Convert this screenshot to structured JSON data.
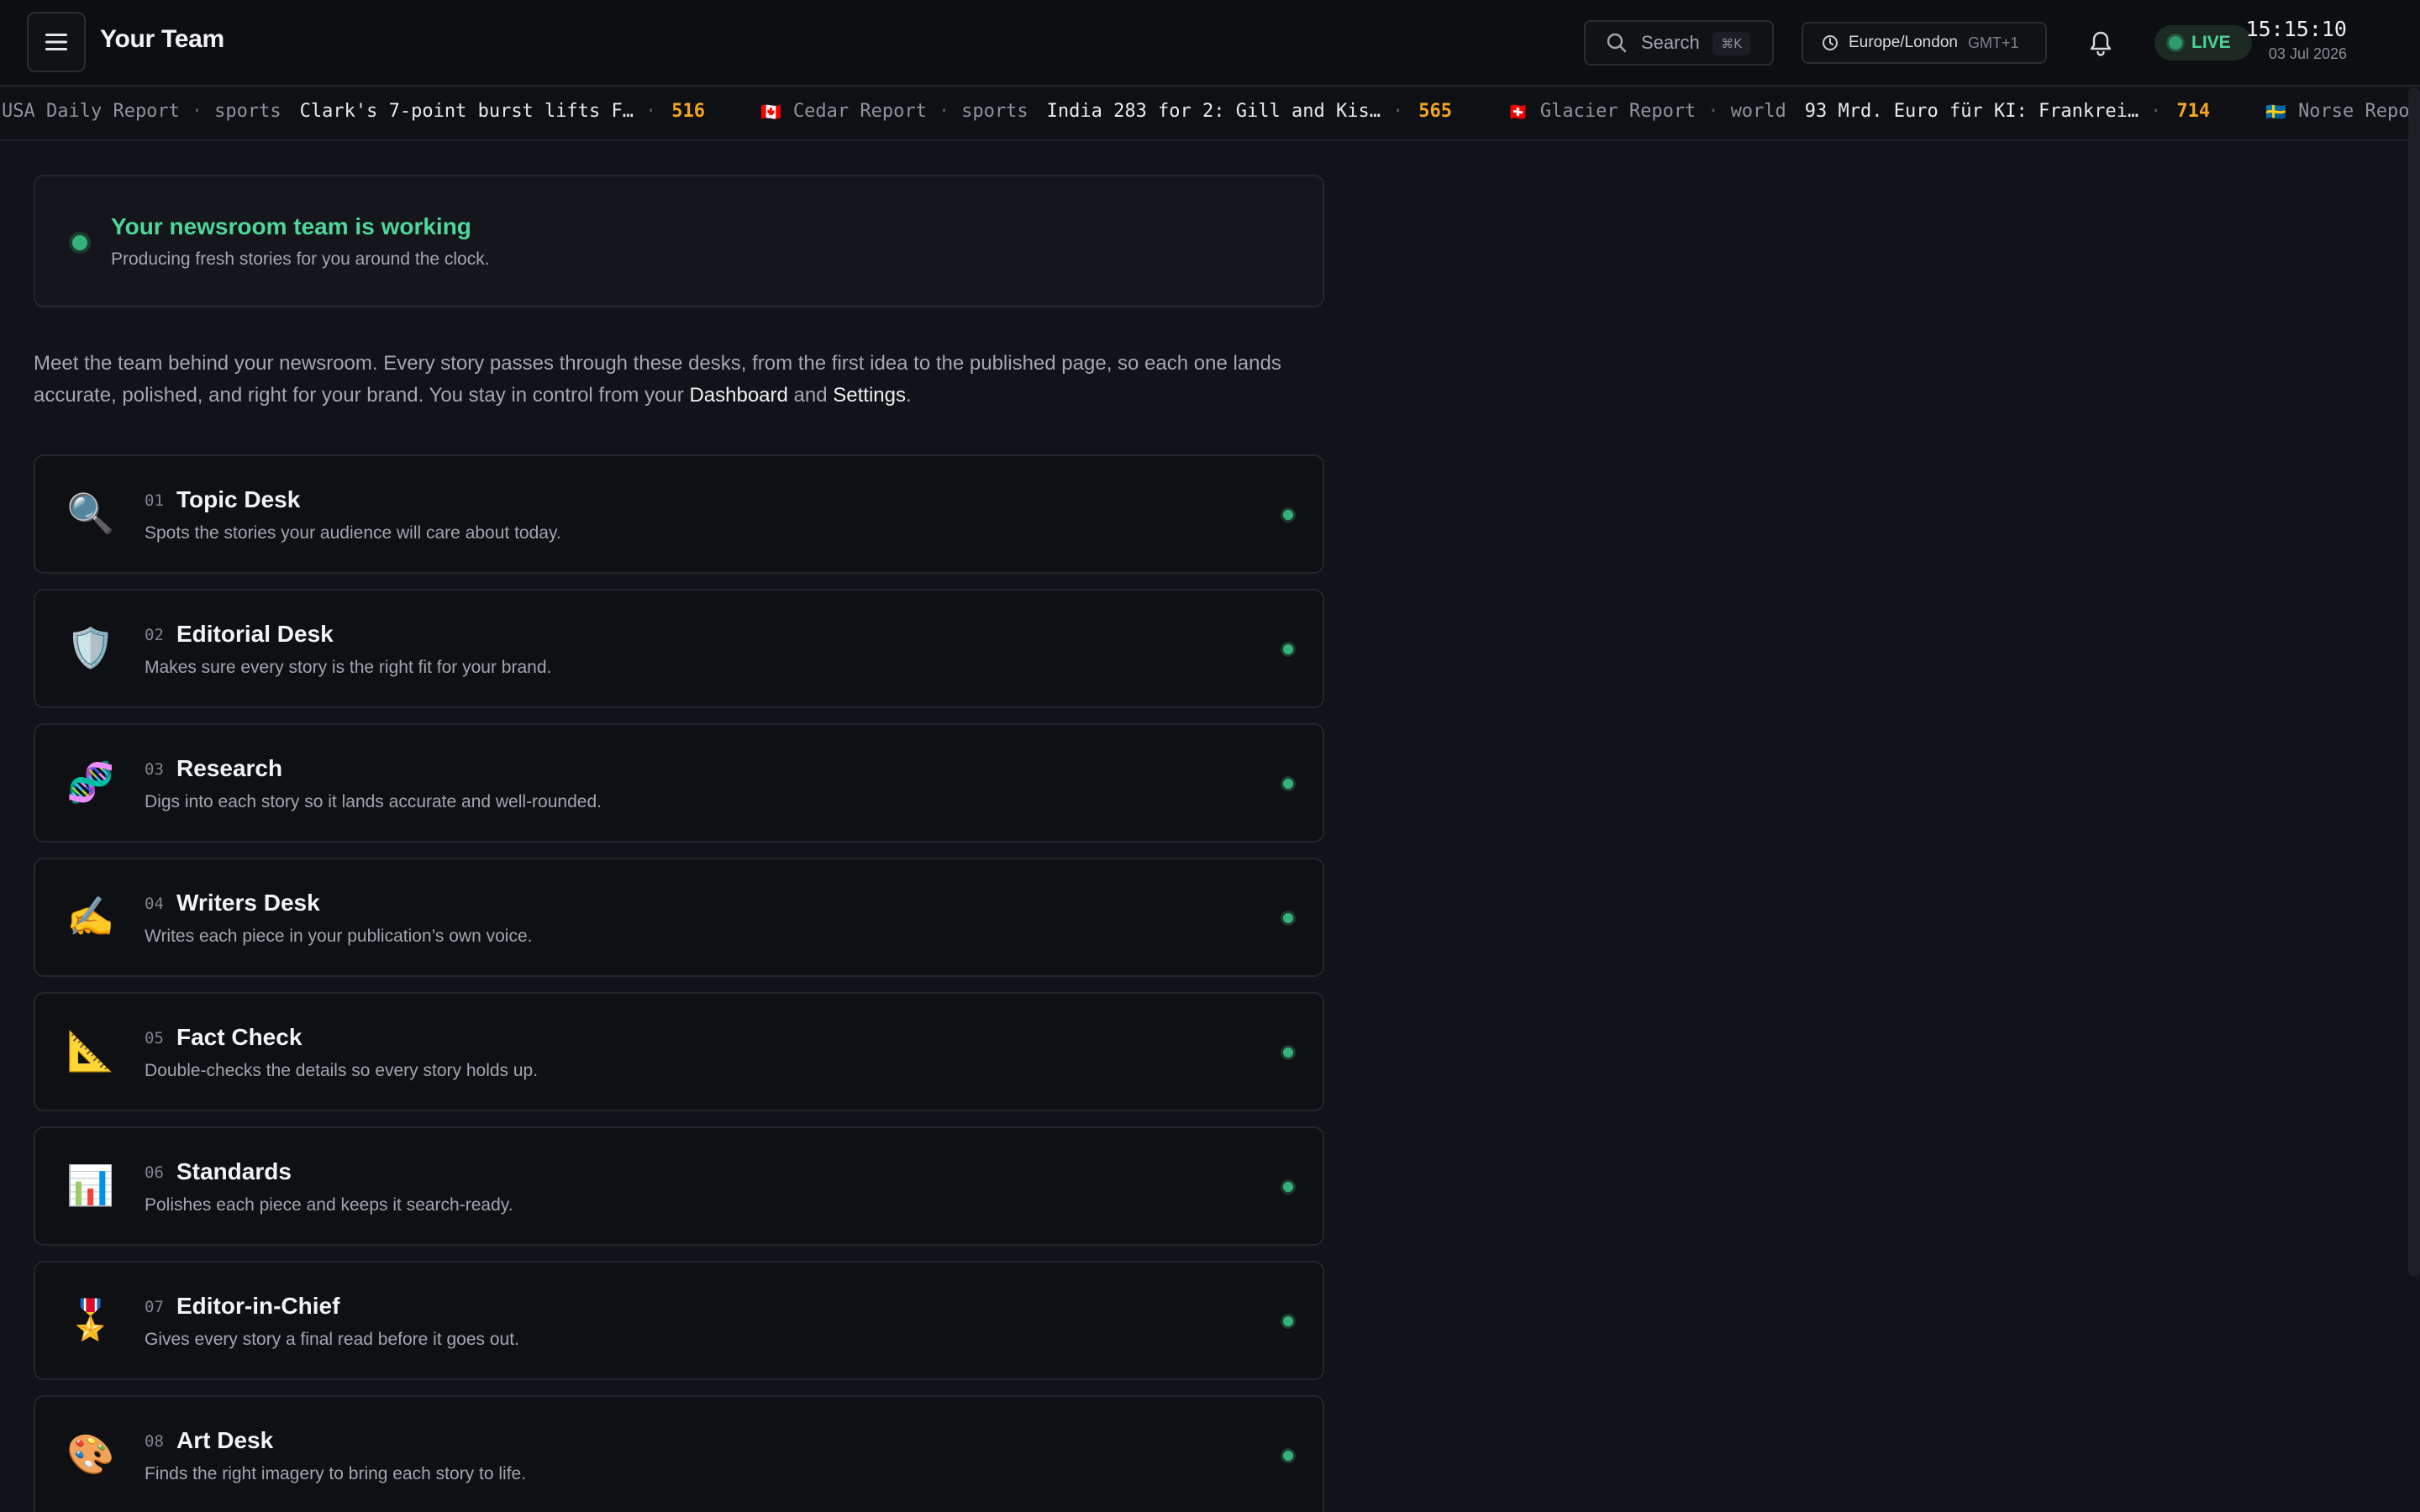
{
  "header": {
    "title": "Your Team",
    "search_label": "Search",
    "search_shortcut": "⌘K",
    "timezone": "Europe/London",
    "timezone_offset": "GMT+1",
    "live_label": "LIVE",
    "time": "15:15:10",
    "date": "03 Jul 2026"
  },
  "ticker": [
    {
      "flag": "",
      "source": "USA Daily Report",
      "category": "sports",
      "headline": "Clark's 7-point burst lifts F…",
      "count": "516"
    },
    {
      "flag": "🇨🇦",
      "source": "Cedar Report",
      "category": "sports",
      "headline": "India 283 for 2: Gill and Kis…",
      "count": "565"
    },
    {
      "flag": "🇨🇭",
      "source": "Glacier Report",
      "category": "world",
      "headline": "93 Mrd. Euro für KI: Frankrei…",
      "count": "714"
    },
    {
      "flag": "🇸🇪",
      "source": "Norse Report",
      "category": "",
      "headline": "",
      "count": ""
    }
  ],
  "status": {
    "title": "Your newsroom team is working",
    "subtitle": "Producing fresh stories for you around the clock."
  },
  "intro": {
    "text": "Meet the team behind your newsroom. Every story passes through these desks, from the first idea to the published page, so each one lands accurate, polished, and right for your brand. You stay in control from your ",
    "link_dashboard": "Dashboard",
    "and": " and ",
    "link_settings": "Settings",
    "end": "."
  },
  "desks": [
    {
      "num": "01",
      "name": "Topic Desk",
      "desc": "Spots the stories your audience will care about today.",
      "icon": "magnifier-icon",
      "glyph": "🔍"
    },
    {
      "num": "02",
      "name": "Editorial Desk",
      "desc": "Makes sure every story is the right fit for your brand.",
      "icon": "shield-icon",
      "glyph": "🛡️"
    },
    {
      "num": "03",
      "name": "Research",
      "desc": "Digs into each story so it lands accurate and well-rounded.",
      "icon": "dna-icon",
      "glyph": "🧬"
    },
    {
      "num": "04",
      "name": "Writers Desk",
      "desc": "Writes each piece in your publication’s own voice.",
      "icon": "writing-hand-icon",
      "glyph": "✍️"
    },
    {
      "num": "05",
      "name": "Fact Check",
      "desc": "Double-checks the details so every story holds up.",
      "icon": "triangle-ruler-icon",
      "glyph": "📐"
    },
    {
      "num": "06",
      "name": "Standards",
      "desc": "Polishes each piece and keeps it search-ready.",
      "icon": "bar-chart-icon",
      "glyph": "📊"
    },
    {
      "num": "07",
      "name": "Editor-in-Chief",
      "desc": "Gives every story a final read before it goes out.",
      "icon": "medal-icon",
      "glyph": "🎖️"
    },
    {
      "num": "08",
      "name": "Art Desk",
      "desc": "Finds the right imagery to bring each story to life.",
      "icon": "palette-icon",
      "glyph": "🎨"
    }
  ],
  "colors": {
    "accent_green": "#4fd69a",
    "count_orange": "#f5a524",
    "background": "#121318"
  }
}
